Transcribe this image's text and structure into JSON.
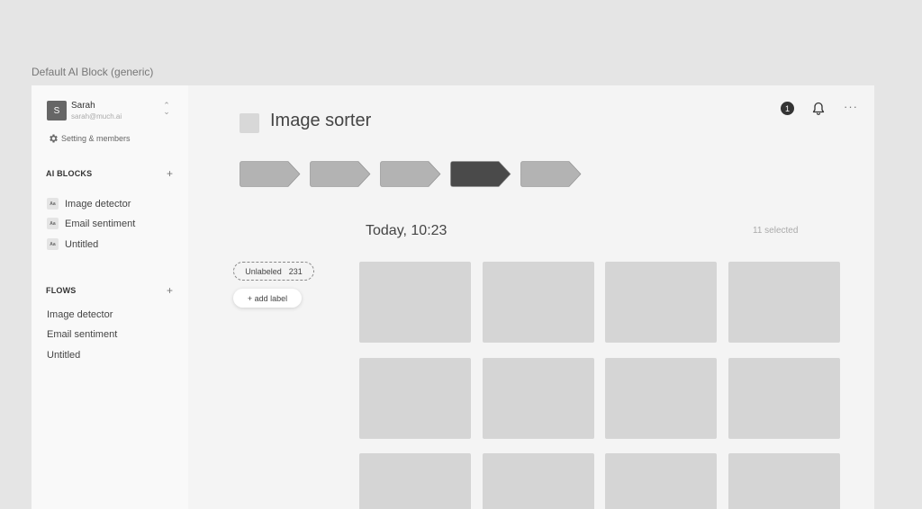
{
  "frame": {
    "label": "Default AI Block (generic)"
  },
  "user": {
    "initial": "S",
    "name": "Sarah",
    "email": "sarah@much.ai"
  },
  "settings": {
    "label": "Setting & members",
    "icon": "gear-icon"
  },
  "ai_blocks": {
    "title": "AI BLOCKS",
    "add": "+",
    "items": [
      {
        "icon_text": "Aa",
        "label": "Image detector"
      },
      {
        "icon_text": "Aa",
        "label": "Email sentiment"
      },
      {
        "icon_text": "Aa",
        "label": "Untitled"
      }
    ]
  },
  "flows": {
    "title": "FLOWS",
    "add": "+",
    "items": [
      {
        "label": "Image detector"
      },
      {
        "label": "Email sentiment"
      },
      {
        "label": "Untitled"
      }
    ]
  },
  "header": {
    "title": "Image sorter",
    "notification_count": "1",
    "more": "···"
  },
  "steps": [
    {
      "active": false
    },
    {
      "active": false
    },
    {
      "active": false
    },
    {
      "active": true
    },
    {
      "active": false
    }
  ],
  "batch": {
    "date": "Today, 10:23",
    "selected": "11 selected"
  },
  "labels": {
    "chip_name": "Unlabeled",
    "chip_count": "231",
    "add_label": "+ add label"
  },
  "thumbnails": {
    "rows": 3,
    "cols": 4
  },
  "colors": {
    "step": "#b3b3b3",
    "step_active": "#4a4a4a",
    "step_stroke": "#8a8a8a",
    "thumbnail": "#d5d5d5"
  }
}
